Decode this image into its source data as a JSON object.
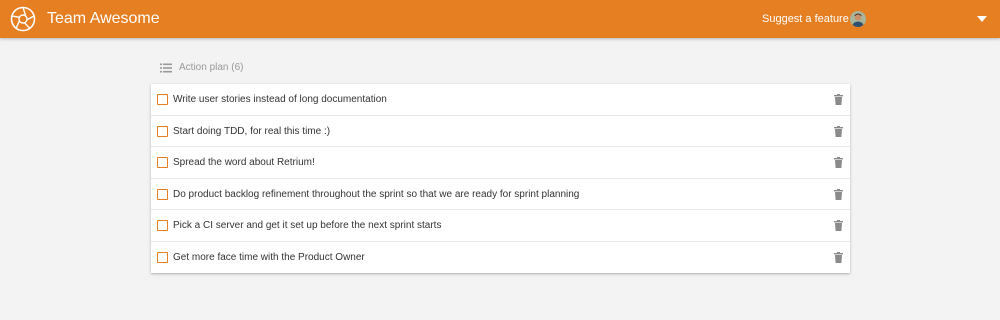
{
  "header": {
    "team_name": "Team Awesome",
    "suggest_label": "Suggest a feature",
    "accent_color": "#e67e22",
    "icons": [
      "aperture-logo-icon",
      "avatar",
      "caret-down-icon"
    ]
  },
  "action_plan": {
    "title": "Action plan (6)",
    "icon": "list-icon",
    "items": [
      {
        "text": "Write user stories instead of long documentation",
        "checked": false
      },
      {
        "text": "Start doing TDD, for real this time :)",
        "checked": false
      },
      {
        "text": "Spread the word about Retrium!",
        "checked": false
      },
      {
        "text": "Do product backlog refinement throughout the sprint so that we are ready for sprint planning",
        "checked": false
      },
      {
        "text": "Pick a CI server and get it set up before the next sprint starts",
        "checked": false
      },
      {
        "text": "Get more face time with the Product Owner",
        "checked": false
      }
    ]
  }
}
